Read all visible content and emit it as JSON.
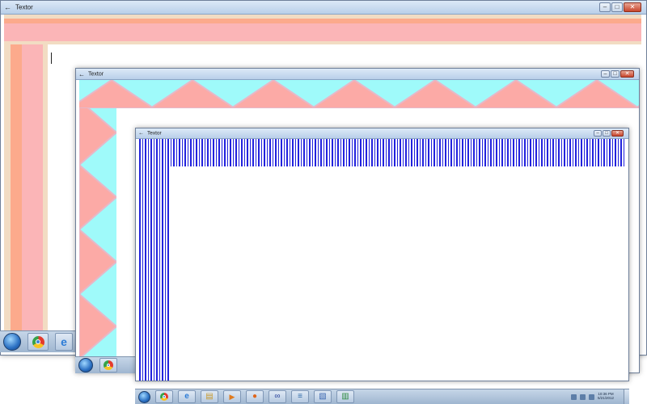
{
  "windows": [
    {
      "title": "Textor",
      "border_colors": {
        "background": "#f2dcc3",
        "peach": "#fcaa8c",
        "pink": "#fbb5b7"
      }
    },
    {
      "title": "Textor",
      "border_colors": {
        "cyan": "#9ffafa",
        "salmon": "#fcaaa6",
        "shade": "#e6b8c8"
      }
    },
    {
      "title": "Textor",
      "border_colors": {
        "stripe": "#2222dd",
        "gap": "#ffffff"
      }
    }
  ],
  "controls": {
    "back_glyph": "←",
    "minimize_glyph": "–",
    "maximize_glyph": "□",
    "close_glyph": "✕"
  },
  "taskbar": {
    "pinned_icons": [
      "start-orb",
      "chrome",
      "internet-explorer",
      "windows-explorer",
      "media-player",
      "firefox",
      "network",
      "notepad",
      "paint",
      "textor"
    ],
    "pinned_glyphs": {
      "internet-explorer": "e",
      "windows-explorer": "▤",
      "media-player": "▶",
      "firefox": "●",
      "network": "∞",
      "notepad": "≡",
      "paint": "▧",
      "textor": "▥"
    },
    "clock_time": "10:36 PM",
    "clock_date": "5/21/2012"
  }
}
